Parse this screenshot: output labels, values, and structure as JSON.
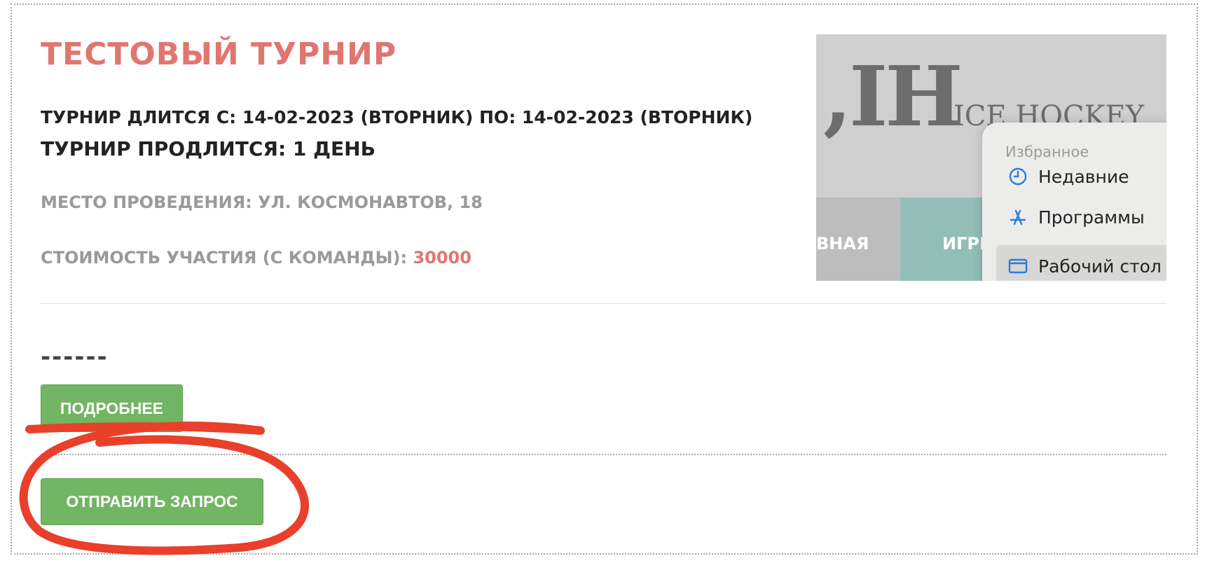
{
  "tournament": {
    "title": "Тестовый турнир",
    "dates": "Турнир длится с: 14-02-2023 (вторник) по: 14-02-2023 (вторник)",
    "duration": "Турнир продлится: 1 день",
    "venue": "Место проведения: ул. Космонавтов, 18",
    "cost_label": "Стоимость участия (с команды): ",
    "cost_value": "30000",
    "dashes": "------"
  },
  "buttons": {
    "more_label": "Подробнее",
    "send_label": "Отправить запрос"
  },
  "thumbnail": {
    "logo_big": ",IH",
    "logo_small": "ICE HOCKEY",
    "nav_left": "ВНАЯ",
    "nav_mid": "ИГРЫ",
    "menu_section": "Избранное",
    "menu_items": [
      "Недавние",
      "Программы",
      "Рабочий стол"
    ]
  },
  "colors": {
    "accent": "#e07670",
    "button": "#72b562",
    "annotation": "#e8402a"
  }
}
